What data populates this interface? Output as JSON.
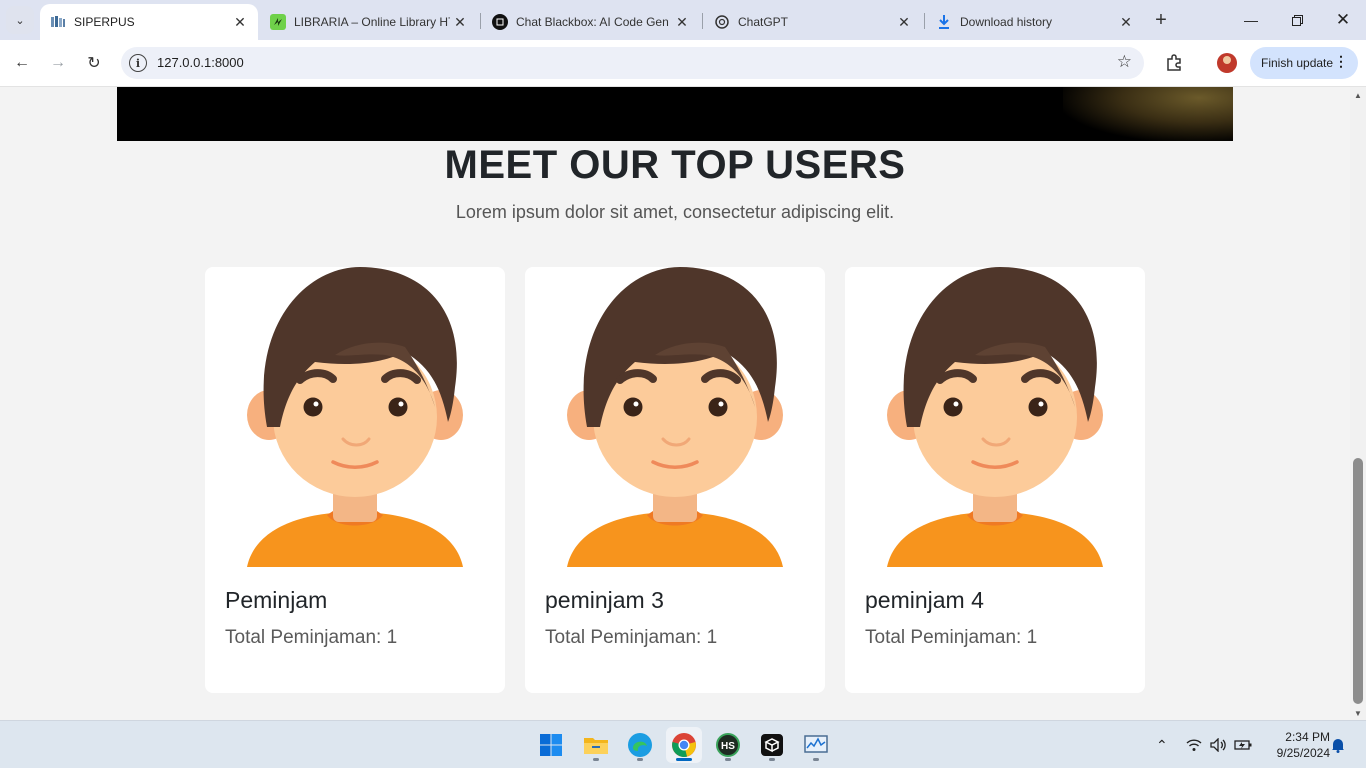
{
  "browser": {
    "tabs": [
      {
        "title": "SIPERPUS",
        "active": true
      },
      {
        "title": "LIBRARIA – Online Library HT",
        "active": false
      },
      {
        "title": "Chat Blackbox: AI Code Gen",
        "active": false
      },
      {
        "title": "ChatGPT",
        "active": false
      },
      {
        "title": "Download history",
        "active": false
      }
    ],
    "url": "127.0.0.1:8000",
    "finish_update_label": "Finish update"
  },
  "page": {
    "section_title": "MEET OUR TOP USERS",
    "section_subtitle": "Lorem ipsum dolor sit amet, consectetur adipiscing elit.",
    "users": [
      {
        "name": "Peminjam",
        "total": "Total Peminjaman: 1"
      },
      {
        "name": "peminjam 3",
        "total": "Total Peminjaman: 1"
      },
      {
        "name": "peminjam 4",
        "total": "Total Peminjaman: 1"
      }
    ]
  },
  "taskbar": {
    "apps": [
      "start-icon",
      "file-explorer-icon",
      "edge-icon",
      "chrome-icon",
      "hs-app-icon",
      "dark-app-icon",
      "monitor-app-icon"
    ],
    "time": "2:34 PM",
    "date": "9/25/2024"
  },
  "colors": {
    "accent": "#0067c0",
    "tabstrip": "#dee3f1",
    "hair": "#4f362a",
    "skin": "#fccb9a",
    "shirt": "#f7941d"
  }
}
